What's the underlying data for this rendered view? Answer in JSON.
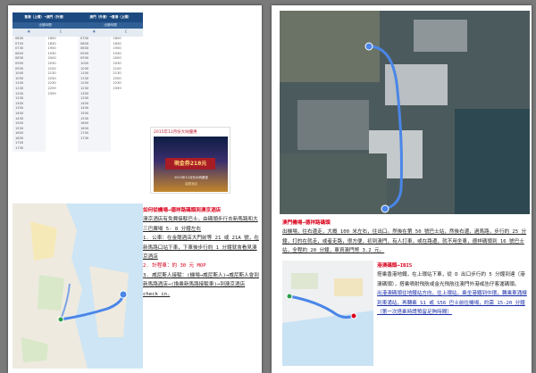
{
  "timetable": {
    "header": [
      "香港（上環）→澳門（外港）",
      "澳門（外港）→香港（上環）"
    ],
    "subheader": [
      "出發時間",
      "出發時間"
    ],
    "icons": [
      "day-icon",
      "night-icon",
      "day-icon",
      "night-icon"
    ],
    "columns": [
      [
        "0630",
        "0700",
        "0730",
        "0800",
        "0830",
        "0900",
        "0930",
        "1000",
        "1030",
        "1100",
        "1130",
        "1200",
        "1230",
        "1300",
        "1330",
        "1400",
        "1430",
        "1500",
        "1530",
        "1600",
        "1630",
        "1700",
        "1730"
      ],
      [
        "1800",
        "1830",
        "1900",
        "1930",
        "2000",
        "2030",
        "2100",
        "2130",
        "2200",
        "2230",
        "2259",
        "2359"
      ],
      [
        "0700",
        "0800",
        "0830",
        "0900",
        "0930",
        "1000",
        "1030",
        "1100",
        "1130",
        "1200",
        "1230",
        "1300",
        "1330",
        "1400",
        "1430",
        "1500",
        "1530",
        "1600",
        "1630",
        "1700",
        "1730"
      ],
      [
        "1800",
        "1830",
        "1900",
        "1930",
        "2000",
        "2030",
        "2100",
        "2130",
        "2200",
        "2230",
        "2359"
      ]
    ]
  },
  "promo": {
    "title": "2015年11月份大呐優惠",
    "banner": "現金券218元",
    "subtitle": "2015年11月份大呐優惠",
    "logo": "金龍酒店"
  },
  "left_notes": {
    "title": "如何從機場→德祥路碼頭到澳京酒店",
    "intro": "澳京酒店有免費接駁巴士，由碼頭步行去新馬路和大三巴廣場 5- 8 分鐘左右",
    "items": [
      "1. 公車：在金龍酒店大門前等 21 或 21A 號，在新馬路口站下車，下車後步行約 1 分鐘就會看見澳京酒店",
      "2. 計程車：約 30 元 MOP",
      "3. 威尼斯人接駁：(機場→威尼斯人)→威尼斯人會到新馬路酒店→(換乘新馬路接駁車)→到澳京酒店 check in."
    ]
  },
  "aerial_caption": {
    "title": "澳門機場→德祥路碼頭",
    "body": "出機場，往右邊走，大概 100 米左右，往出口。然後在第 50 號巴士站，然後右邊，過馬路，步行約 25 分鐘，打的在就走，或者走路，很方便，初到澳門，有人打車，或在路邊，就不用坐車，德祥碼頭到 16 號巴士站，全程約 20 分鐘，車資澳門幣 3.2 元。"
  },
  "right_notes": {
    "title": "港澳碼頭→IBIS",
    "p1": "搭乘香港地鐵，在上環站下車，從 D 出口步行約 5 分鐘到達（港澳碼頭），搭乘噴射飛航或金光飛航往澳門外港或氹仔客運碼頭。",
    "p2": "出港澳碼頭往地鐵站方向，往上環站，乘坐港鐵到中環，轉乘東涌線到東涌站，再轉乘 S1 或 S56 巴士前往機場，約需 15-20 分鐘（第一次搭乘時請預留足夠時間）"
  }
}
